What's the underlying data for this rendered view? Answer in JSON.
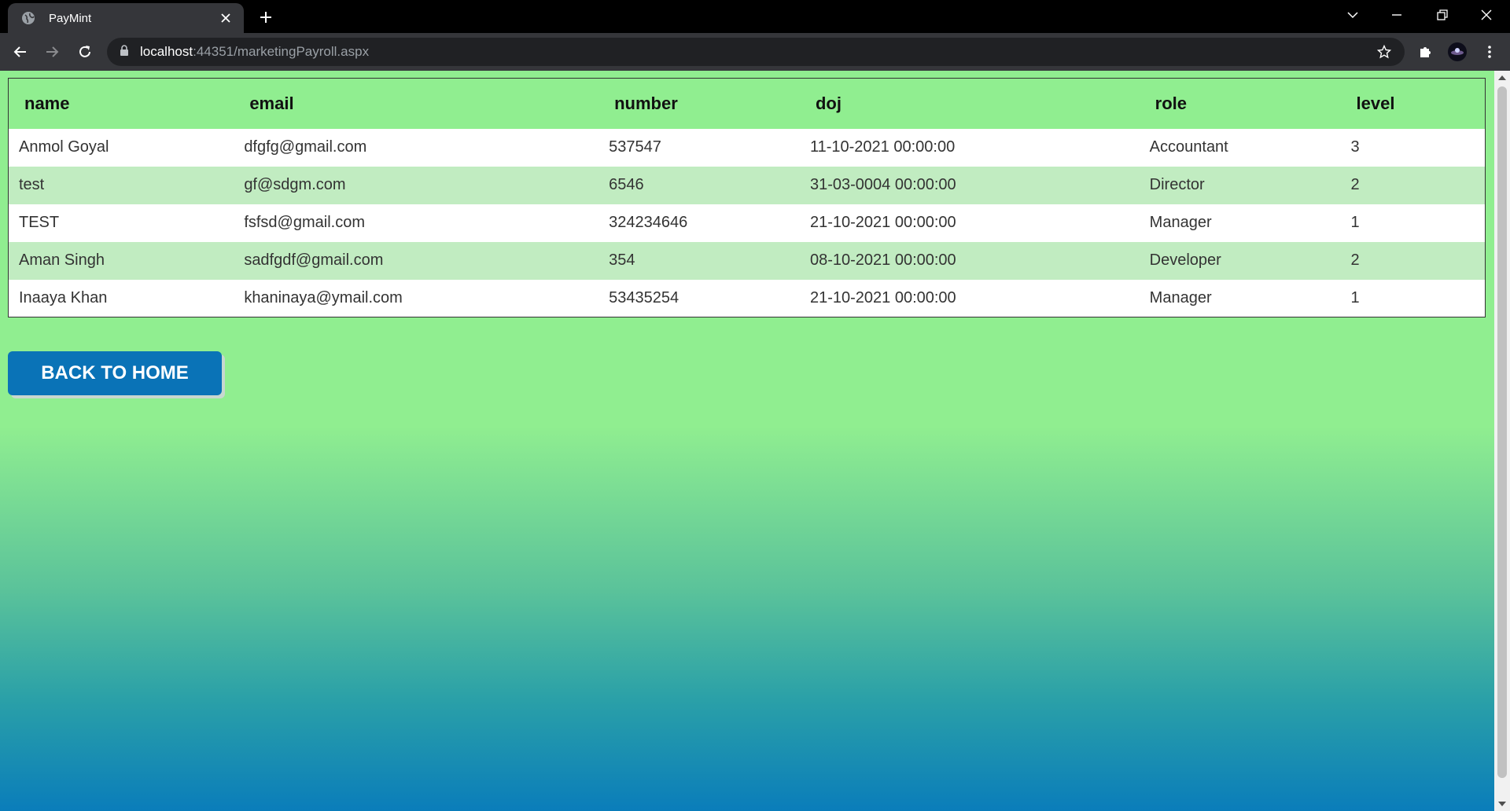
{
  "browser": {
    "tab_title": "PayMint",
    "url_host": "localhost",
    "url_rest": ":44351/marketingPayroll.aspx"
  },
  "table": {
    "headers": [
      "name",
      "email",
      "number",
      "doj",
      "role",
      "level"
    ],
    "rows": [
      [
        "Anmol Goyal",
        "dfgfg@gmail.com",
        "537547",
        "11-10-2021 00:00:00",
        "Accountant",
        "3"
      ],
      [
        "test",
        "gf@sdgm.com",
        "6546",
        "31-03-0004 00:00:00",
        "Director",
        "2"
      ],
      [
        "TEST",
        "fsfsd@gmail.com",
        "324234646",
        "21-10-2021 00:00:00",
        "Manager",
        "1"
      ],
      [
        "Aman Singh",
        "sadfgdf@gmail.com",
        "354",
        "08-10-2021 00:00:00",
        "Developer",
        "2"
      ],
      [
        "Inaaya Khan",
        "khaninaya@ymail.com",
        "53435254",
        "21-10-2021 00:00:00",
        "Manager",
        "1"
      ]
    ]
  },
  "actions": {
    "back_home_label": "BACK TO HOME"
  }
}
